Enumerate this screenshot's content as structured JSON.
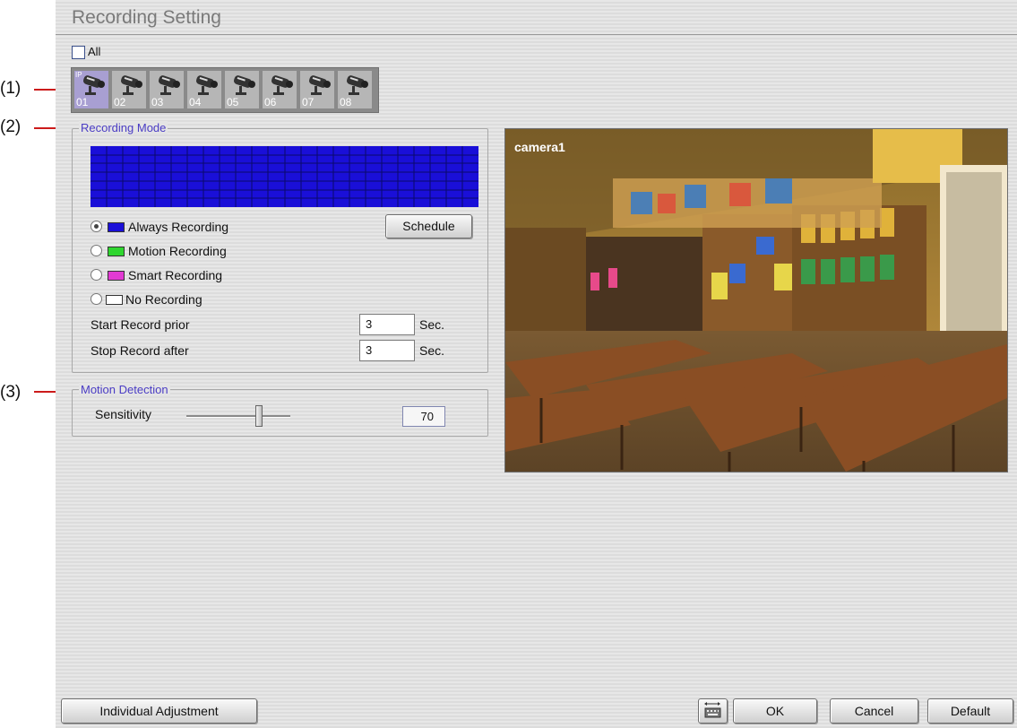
{
  "callouts": [
    "(1)",
    "(2)",
    "(3)"
  ],
  "window": {
    "title": "Recording Setting"
  },
  "all_checkbox": {
    "label": "All",
    "checked": false
  },
  "cameras": [
    {
      "num": "01",
      "ip_badge": "IP",
      "selected": true
    },
    {
      "num": "02"
    },
    {
      "num": "03"
    },
    {
      "num": "04"
    },
    {
      "num": "05"
    },
    {
      "num": "06"
    },
    {
      "num": "07"
    },
    {
      "num": "08"
    }
  ],
  "recording_mode": {
    "legend": "Recording Mode",
    "schedule_button": "Schedule",
    "options": [
      {
        "label": "Always Recording",
        "color": "#1a0fd8",
        "selected": true
      },
      {
        "label": "Motion Recording",
        "color": "#2fd62f"
      },
      {
        "label": "Smart Recording",
        "color": "#e23ad3"
      },
      {
        "label": "No Recording",
        "color": "#ffffff"
      }
    ],
    "start_prior": {
      "label": "Start Record prior",
      "value": "3",
      "unit": "Sec."
    },
    "stop_after": {
      "label": "Stop Record after",
      "value": "3",
      "unit": "Sec."
    }
  },
  "motion_detection": {
    "legend": "Motion Detection",
    "sensitivity_label": "Sensitivity",
    "sensitivity_value": "70",
    "sensitivity_level": 70
  },
  "preview": {
    "camera_label": "camera1"
  },
  "footer": {
    "individual_adjustment": "Individual Adjustment",
    "keyboard_icon": "keyboard-icon",
    "ok": "OK",
    "cancel": "Cancel",
    "default": "Default"
  }
}
